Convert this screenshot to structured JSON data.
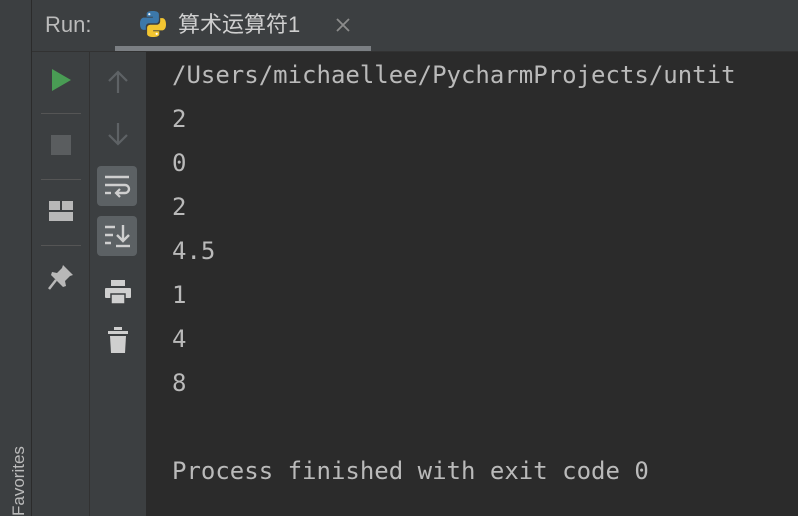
{
  "run_panel": {
    "label": "Run:",
    "tab": {
      "title": "算术运算符1",
      "icon": "python-icon",
      "close_icon": "close-icon"
    }
  },
  "side_strip": {
    "label": "Favorites"
  },
  "toolbar_primary": [
    {
      "name": "rerun-button",
      "icon": "play-icon",
      "color": "#499c54"
    },
    {
      "name": "stop-button",
      "icon": "stop-icon"
    },
    {
      "name": "layout-button",
      "icon": "layout-icon"
    },
    {
      "name": "pin-button",
      "icon": "pin-icon"
    }
  ],
  "toolbar_secondary": [
    {
      "name": "up-stack-button",
      "icon": "arrow-up-icon"
    },
    {
      "name": "down-stack-button",
      "icon": "arrow-down-icon"
    },
    {
      "name": "soft-wrap-button",
      "icon": "soft-wrap-icon",
      "active": true
    },
    {
      "name": "scroll-to-end-button",
      "icon": "scroll-to-end-icon",
      "active": true
    },
    {
      "name": "print-button",
      "icon": "print-icon"
    },
    {
      "name": "clear-button",
      "icon": "trash-icon"
    }
  ],
  "console": {
    "path": "/Users/michaellee/PycharmProjects/untit",
    "outputs": [
      "2",
      "0",
      "2",
      "4.5",
      "1",
      "4",
      "8"
    ],
    "blank": "",
    "exit_message": "Process finished with exit code 0"
  },
  "colors": {
    "background": "#3c3f41",
    "console_bg": "#2b2b2b",
    "text": "#bababa",
    "run_green": "#499c54"
  }
}
